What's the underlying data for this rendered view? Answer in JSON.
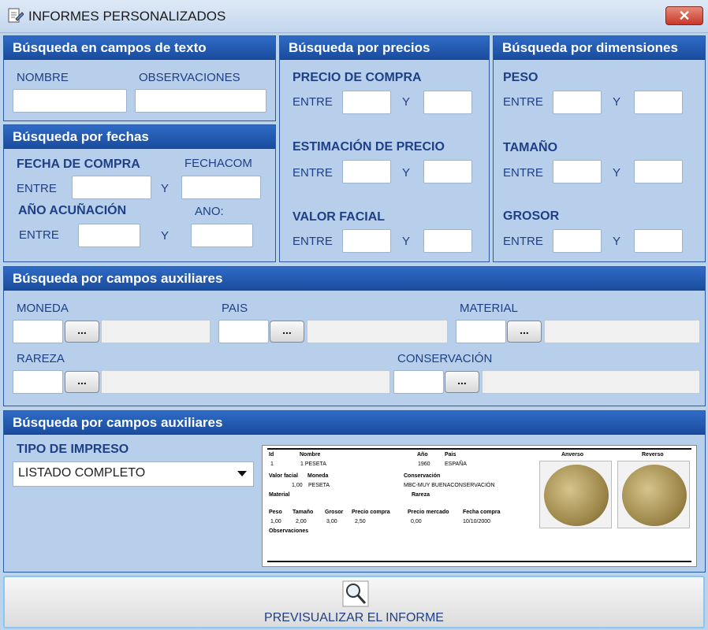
{
  "window": {
    "title": "INFORMES PERSONALIZADOS",
    "close_label": "✕"
  },
  "texto": {
    "header": "Búsqueda en campos de texto",
    "nombre": "NOMBRE",
    "observaciones": "OBSERVACIONES"
  },
  "fechas": {
    "header": "Búsqueda por fechas",
    "fecha_compra": "FECHA DE COMPRA",
    "fechacom": "FECHACOM",
    "entre": "ENTRE",
    "y": "Y",
    "ano_acunacion": "AÑO ACUÑACIÓN",
    "ano": "ANO:"
  },
  "precios": {
    "header": "Búsqueda por precios",
    "precio_compra": "PRECIO DE COMPRA",
    "estimacion": "ESTIMACIÓN DE PRECIO",
    "valor_facial": "VALOR FACIAL",
    "entre": "ENTRE",
    "y": "Y"
  },
  "dimensiones": {
    "header": "Búsqueda por dimensiones",
    "peso": "PESO",
    "tamano": "TAMAÑO",
    "grosor": "GROSOR",
    "entre": "ENTRE",
    "y": "Y"
  },
  "auxiliares": {
    "header": "Búsqueda por campos auxiliares",
    "moneda": "MONEDA",
    "pais": "PAIS",
    "material": "MATERIAL",
    "rareza": "RAREZA",
    "conservacion": "CONSERVACIÓN",
    "dots": "..."
  },
  "impreso": {
    "header": "Búsqueda por campos auxiliares",
    "tipo_label": "TIPO DE IMPRESO",
    "tipo_value": "LISTADO COMPLETO"
  },
  "preview": {
    "id_h": "Id",
    "nombre_h": "Nombre",
    "ano_h": "Año",
    "pais_h": "Pais",
    "anverso_h": "Anverso",
    "reverso_h": "Reverso",
    "id_v": "1",
    "nombre_v": "1 PESETA",
    "ano_v": "1960",
    "pais_v": "ESPAÑA",
    "valorfacial_h": "Valor facial",
    "moneda_h": "Moneda",
    "conservacion_h": "Conservación",
    "valorfacial_v": "1,00",
    "moneda_v": "PESETA",
    "conservacion_v": "MBC-MUY BUENACONSERVACIÓN",
    "material_h": "Material",
    "rareza_h": "Rareza",
    "peso_h": "Peso",
    "tamano_h": "Tamaño",
    "grosor_h": "Grosor",
    "preciocompra_h": "Precio compra",
    "preciomercado_h": "Precio mercado",
    "fechacompra_h": "Fecha compra",
    "peso_v": "1,00",
    "tamano_v": "2,00",
    "grosor_v": "3,00",
    "preciocompra_v": "2,50",
    "preciomercado_v": "0,00",
    "fechacompra_v": "10/10/2000",
    "observaciones_h": "Observaciones"
  },
  "footer": {
    "preview_button": "PREVISUALIZAR EL INFORME"
  }
}
